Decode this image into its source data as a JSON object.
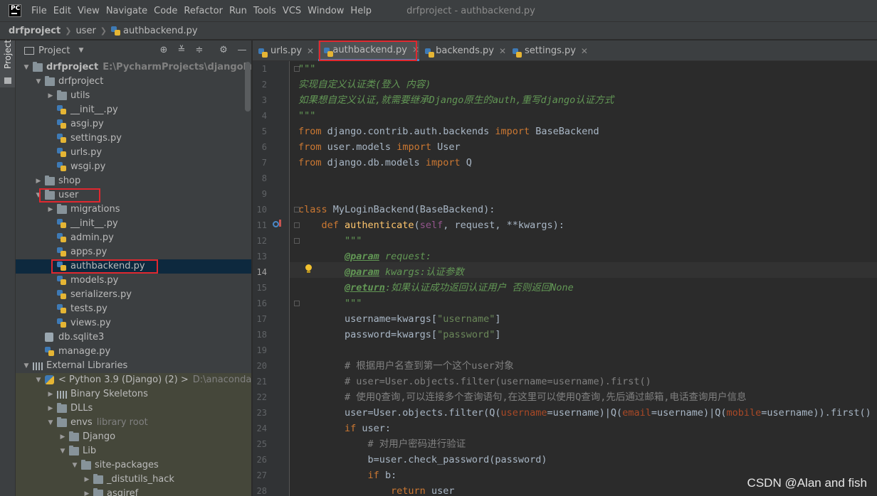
{
  "window": {
    "title": "drfproject - authbackend.py",
    "logo": "PC"
  },
  "menu": [
    "File",
    "Edit",
    "View",
    "Navigate",
    "Code",
    "Refactor",
    "Run",
    "Tools",
    "VCS",
    "Window",
    "Help"
  ],
  "breadcrumb": {
    "project": "drfproject",
    "folder": "user",
    "file": "authbackend.py"
  },
  "tool_strip": {
    "label": "Project"
  },
  "project_panel": {
    "title": "Project",
    "header_icons": [
      "locate-icon",
      "expand-all-icon",
      "collapse-all-icon",
      "settings-icon",
      "minimize-icon"
    ],
    "tree": [
      {
        "label": "drfproject",
        "hint": "E:\\PycharmProjects\\djangoProject\\drf",
        "icon": "folder",
        "arrow": "open",
        "indent": 0,
        "bold": true
      },
      {
        "label": "drfproject",
        "icon": "folder",
        "arrow": "open",
        "indent": 1
      },
      {
        "label": "utils",
        "icon": "folder",
        "arrow": "closed",
        "indent": 2
      },
      {
        "label": "__init__.py",
        "icon": "py",
        "indent": 2
      },
      {
        "label": "asgi.py",
        "icon": "py",
        "indent": 2
      },
      {
        "label": "settings.py",
        "icon": "py",
        "indent": 2
      },
      {
        "label": "urls.py",
        "icon": "py",
        "indent": 2
      },
      {
        "label": "wsgi.py",
        "icon": "py",
        "indent": 2
      },
      {
        "label": "shop",
        "icon": "folder",
        "arrow": "closed",
        "indent": 1
      },
      {
        "label": "user",
        "icon": "folder",
        "arrow": "open",
        "indent": 1,
        "boxed": true
      },
      {
        "label": "migrations",
        "icon": "folder",
        "arrow": "closed",
        "indent": 2
      },
      {
        "label": "__init__.py",
        "icon": "py",
        "indent": 2
      },
      {
        "label": "admin.py",
        "icon": "py",
        "indent": 2
      },
      {
        "label": "apps.py",
        "icon": "py",
        "indent": 2
      },
      {
        "label": "authbackend.py",
        "icon": "py",
        "indent": 2,
        "selected": true,
        "boxed": true
      },
      {
        "label": "models.py",
        "icon": "py",
        "indent": 2
      },
      {
        "label": "serializers.py",
        "icon": "py",
        "indent": 2
      },
      {
        "label": "tests.py",
        "icon": "py",
        "indent": 2
      },
      {
        "label": "views.py",
        "icon": "py",
        "indent": 2
      },
      {
        "label": "db.sqlite3",
        "icon": "db",
        "indent": 1
      },
      {
        "label": "manage.py",
        "icon": "py",
        "indent": 1
      },
      {
        "label": "External Libraries",
        "icon": "lib",
        "arrow": "open",
        "indent": 0
      },
      {
        "label": "< Python 3.9 (Django) (2) >",
        "hint": "D:\\anaconda\\envs\\",
        "icon": "python",
        "arrow": "open",
        "indent": 1,
        "lib": true
      },
      {
        "label": "Binary Skeletons",
        "icon": "lib",
        "arrow": "closed",
        "indent": 2,
        "lib": true
      },
      {
        "label": "DLLs",
        "icon": "folder",
        "arrow": "closed",
        "indent": 2,
        "lib": true
      },
      {
        "label": "envs",
        "hint": "library root",
        "icon": "folder",
        "arrow": "open",
        "indent": 2,
        "lib": true
      },
      {
        "label": "Django",
        "icon": "folder",
        "arrow": "closed",
        "indent": 3,
        "lib": true
      },
      {
        "label": "Lib",
        "icon": "folder",
        "arrow": "open",
        "indent": 3,
        "lib": true
      },
      {
        "label": "site-packages",
        "icon": "folder",
        "arrow": "open",
        "indent": 4,
        "lib": true
      },
      {
        "label": "_distutils_hack",
        "icon": "folder",
        "arrow": "closed",
        "indent": 5,
        "lib": true
      },
      {
        "label": "asgiref",
        "icon": "folder",
        "arrow": "closed",
        "indent": 5,
        "lib": true
      }
    ]
  },
  "tabs": [
    {
      "label": "urls.py",
      "active": false
    },
    {
      "label": "authbackend.py",
      "active": true
    },
    {
      "label": "backends.py",
      "active": false
    },
    {
      "label": "settings.py",
      "active": false
    }
  ],
  "editor": {
    "current_line": 14,
    "lines": [
      {
        "n": 1,
        "tokens": [
          [
            "doc",
            "\"\"\""
          ]
        ]
      },
      {
        "n": 2,
        "tokens": [
          [
            "doc",
            "实现自定义认证类(登入 内容)"
          ]
        ]
      },
      {
        "n": 3,
        "tokens": [
          [
            "doc",
            "如果想自定义认证,就需要继承Django原生的auth,重写django认证方式"
          ]
        ]
      },
      {
        "n": 4,
        "tokens": [
          [
            "doc",
            "\"\"\""
          ]
        ]
      },
      {
        "n": 5,
        "tokens": [
          [
            "kw",
            "from "
          ],
          [
            "",
            "django.contrib.auth.backends "
          ],
          [
            "kw",
            "import "
          ],
          [
            "",
            "BaseBackend"
          ]
        ]
      },
      {
        "n": 6,
        "tokens": [
          [
            "kw",
            "from "
          ],
          [
            "",
            "user.models "
          ],
          [
            "kw",
            "import "
          ],
          [
            "",
            "User"
          ]
        ]
      },
      {
        "n": 7,
        "tokens": [
          [
            "kw",
            "from "
          ],
          [
            "",
            "django.db.models "
          ],
          [
            "kw",
            "import "
          ],
          [
            "",
            "Q"
          ]
        ]
      },
      {
        "n": 8,
        "tokens": []
      },
      {
        "n": 9,
        "tokens": []
      },
      {
        "n": 10,
        "tokens": [
          [
            "kw",
            "class "
          ],
          [
            "",
            "MyLoginBackend(BaseBackend):"
          ]
        ]
      },
      {
        "n": 11,
        "tokens": [
          [
            "",
            "    "
          ],
          [
            "kw",
            "def "
          ],
          [
            "fn",
            "authenticate"
          ],
          [
            "",
            "("
          ],
          [
            "self",
            "self"
          ],
          [
            "",
            ", request, **kwargs):"
          ]
        ]
      },
      {
        "n": 12,
        "tokens": [
          [
            "",
            "        "
          ],
          [
            "doc",
            "\"\"\""
          ]
        ]
      },
      {
        "n": 13,
        "tokens": [
          [
            "",
            "        "
          ],
          [
            "doct",
            "@param"
          ],
          [
            "doc",
            " request:"
          ]
        ]
      },
      {
        "n": 14,
        "tokens": [
          [
            "",
            "        "
          ],
          [
            "doct",
            "@param"
          ],
          [
            "doc",
            " kwargs:认证参数"
          ]
        ]
      },
      {
        "n": 15,
        "tokens": [
          [
            "",
            "        "
          ],
          [
            "doct",
            "@return"
          ],
          [
            "doc",
            ":如果认证成功返回认证用户 否则返回None"
          ]
        ]
      },
      {
        "n": 16,
        "tokens": [
          [
            "",
            "        "
          ],
          [
            "doc",
            "\"\"\""
          ]
        ]
      },
      {
        "n": 17,
        "tokens": [
          [
            "",
            "        username=kwargs["
          ],
          [
            "str",
            "\"username\""
          ],
          [
            "",
            "]"
          ]
        ]
      },
      {
        "n": 18,
        "tokens": [
          [
            "",
            "        password=kwargs["
          ],
          [
            "str",
            "\"password\""
          ],
          [
            "",
            "]"
          ]
        ]
      },
      {
        "n": 19,
        "tokens": []
      },
      {
        "n": 20,
        "tokens": [
          [
            "",
            "        "
          ],
          [
            "cmt",
            "# 根据用户名查到第一个这个user对象"
          ]
        ]
      },
      {
        "n": 21,
        "tokens": [
          [
            "",
            "        "
          ],
          [
            "cmt",
            "# user=User.objects.filter(username=username).first()"
          ]
        ]
      },
      {
        "n": 22,
        "tokens": [
          [
            "",
            "        "
          ],
          [
            "cmt",
            "# 使用Q查询,可以连接多个查询语句,在这里可以使用Q查询,先后通过邮箱,电话查询用户信息"
          ]
        ]
      },
      {
        "n": 23,
        "tokens": [
          [
            "",
            "        user=User.objects.filter(Q("
          ],
          [
            "prm",
            "username"
          ],
          [
            "",
            "=username)|Q("
          ],
          [
            "prm",
            "email"
          ],
          [
            "",
            "=username)|Q("
          ],
          [
            "prm",
            "mobile"
          ],
          [
            "",
            "=username)).first()"
          ]
        ]
      },
      {
        "n": 24,
        "tokens": [
          [
            "",
            "        "
          ],
          [
            "kw",
            "if "
          ],
          [
            "",
            "user:"
          ]
        ]
      },
      {
        "n": 25,
        "tokens": [
          [
            "",
            "            "
          ],
          [
            "cmt",
            "# 对用户密码进行验证"
          ]
        ]
      },
      {
        "n": 26,
        "tokens": [
          [
            "",
            "            b=user.check_password(password)"
          ]
        ]
      },
      {
        "n": 27,
        "tokens": [
          [
            "",
            "            "
          ],
          [
            "kw",
            "if "
          ],
          [
            "",
            "b:"
          ]
        ]
      },
      {
        "n": 28,
        "tokens": [
          [
            "",
            "                "
          ],
          [
            "kw",
            "return "
          ],
          [
            "",
            "user"
          ]
        ]
      }
    ]
  },
  "watermark": "CSDN @Alan and fish"
}
